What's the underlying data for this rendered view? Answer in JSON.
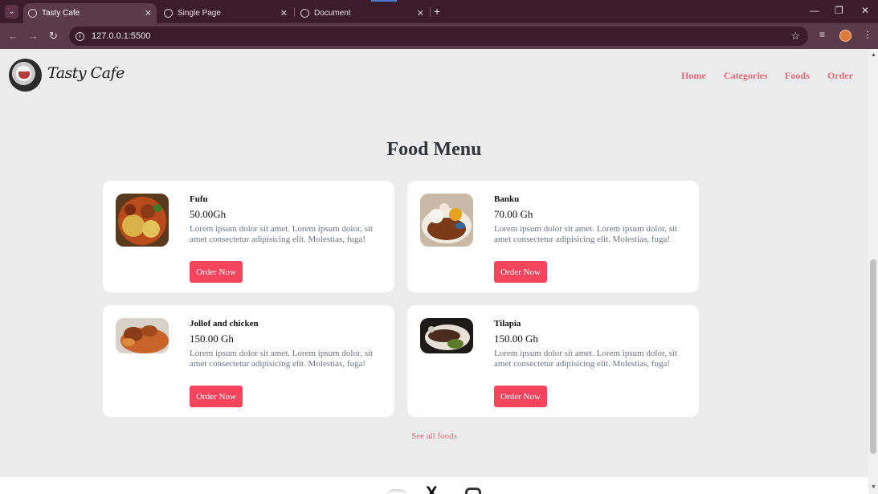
{
  "browser": {
    "tabs": [
      {
        "title": "Tasty Cafe",
        "active": true
      },
      {
        "title": "Single Page",
        "active": false
      },
      {
        "title": "Document",
        "active": false
      }
    ],
    "url": "127.0.0.1:5500"
  },
  "header": {
    "logo_text": "Tasty Cafe",
    "nav": [
      "Home",
      "Categories",
      "Foods",
      "Order"
    ]
  },
  "menu": {
    "title": "Food Menu",
    "items": [
      {
        "name": "Fufu",
        "price": "50.00Gh",
        "description": "Lorem ipsum dolor sit amet. Lorem ipsum dolor, sit amet consectetur adipisicing elit. Molestias, fuga!",
        "button": "Order Now"
      },
      {
        "name": "Banku",
        "price": "70.00 Gh",
        "description": "Lorem ipsum dolor sit amet. Lorem ipsum dolor, sit amet consectetur adipisicing elit. Molestias, fuga!",
        "button": "Order Now"
      },
      {
        "name": "Jollof and chicken",
        "price": "150.00 Gh",
        "description": "Lorem ipsum dolor sit amet. Lorem ipsum dolor, sit amet consectetur adipisicing elit. Molestias, fuga!",
        "button": "Order Now"
      },
      {
        "name": "Tilapia",
        "price": "150.00 Gh",
        "description": "Lorem ipsum dolor sit amet. Lorem ipsum dolor, sit amet consectetur adipisicing elit. Molestias, fuga!",
        "button": "Order Now"
      }
    ],
    "see_all": "See all foods"
  },
  "colors": {
    "accent": "#f5455c",
    "nav_link": "#ef6a78",
    "page_bg": "#ececec",
    "browser_frame": "#3a1c2b"
  },
  "icons": {
    "footer": [
      "social-icon",
      "x-icon",
      "instagram-icon"
    ]
  }
}
